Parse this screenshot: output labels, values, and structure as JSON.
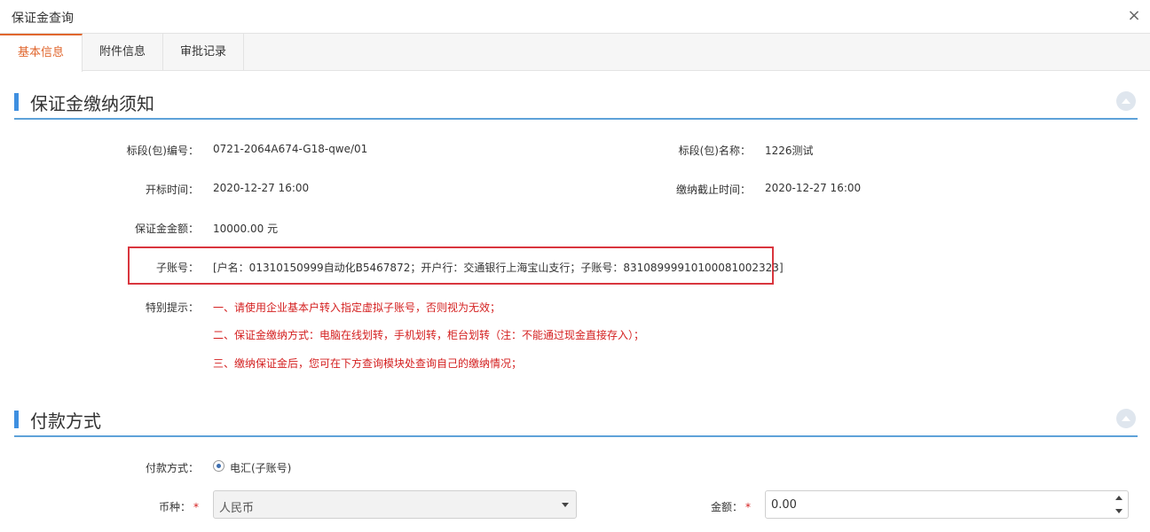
{
  "window": {
    "title": "保证金查询",
    "close_symbol": "×"
  },
  "tabs": [
    {
      "label": "基本信息",
      "active": true
    },
    {
      "label": "附件信息",
      "active": false
    },
    {
      "label": "审批记录",
      "active": false
    }
  ],
  "notice_section": {
    "title": "保证金缴纳须知",
    "fields": {
      "bid_no_label": "标段(包)编号：",
      "bid_no_value": "0721-2064A674-G18-qwe/01",
      "bid_name_label": "标段(包)名称：",
      "bid_name_value": "1226测试",
      "open_time_label": "开标时间：",
      "open_time_value": "2020-12-27 16:00",
      "deadline_label": "缴纳截止时间：",
      "deadline_value": "2020-12-27 16:00",
      "amount_label": "保证金金额：",
      "amount_value": "10000.00 元",
      "sub_account_label": "子账号：",
      "sub_account_value": "[户名：01310150999自动化B5467872；开户行：交通银行上海宝山支行；子账号：83108999910100081002323]",
      "tips_label": "特别提示：",
      "tips": [
        "一、请使用企业基本户转入指定虚拟子账号，否则视为无效；",
        "二、保证金缴纳方式：电脑在线划转，手机划转，柜台划转（注：不能通过现金直接存入）；",
        "三、缴纳保证金后，您可在下方查询模块处查询自己的缴纳情况；"
      ]
    }
  },
  "payment_section": {
    "title": "付款方式",
    "method_label": "付款方式：",
    "method_option": "电汇(子账号)",
    "currency_label": "币种：",
    "currency_value": "人民币",
    "amount_label": "金额：",
    "amount_value": "0.00",
    "required_mark": "*"
  },
  "colors": {
    "accent_orange": "#e0662d",
    "section_blue": "#3e8fe0",
    "warning_red": "#d42020",
    "highlight_border": "#d9363e"
  }
}
